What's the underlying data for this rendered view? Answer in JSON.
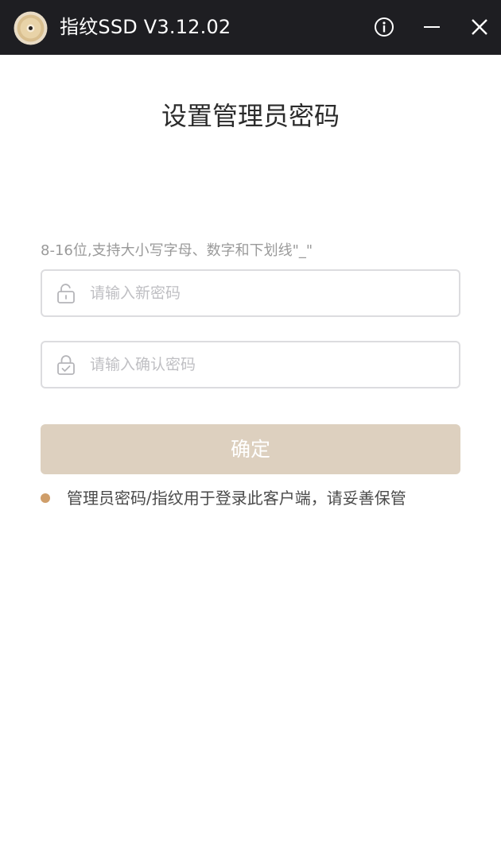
{
  "window": {
    "title": "指纹SSD V3.12.02",
    "icons": {
      "logo": "disc-logo-icon",
      "info": "info-icon",
      "minimize": "minimize-icon",
      "close": "close-icon"
    }
  },
  "main": {
    "page_title": "设置管理员密码",
    "hint": "8-16位,支持大小写字母、数字和下划线\"_\"",
    "new_password": {
      "value": "",
      "placeholder": "请输入新密码",
      "icon": "unlock-icon"
    },
    "confirm_password": {
      "value": "",
      "placeholder": "请输入确认密码",
      "icon": "lock-check-icon"
    },
    "confirm_button_label": "确定",
    "note": "管理员密码/指纹用于登录此客户端，请妥善保管"
  },
  "colors": {
    "titlebar_bg": "#1e1e22",
    "button_bg": "#ddd0bf",
    "accent_dot": "#cf9e6a",
    "border": "#dcdcdf",
    "placeholder": "#bfbfc3"
  }
}
